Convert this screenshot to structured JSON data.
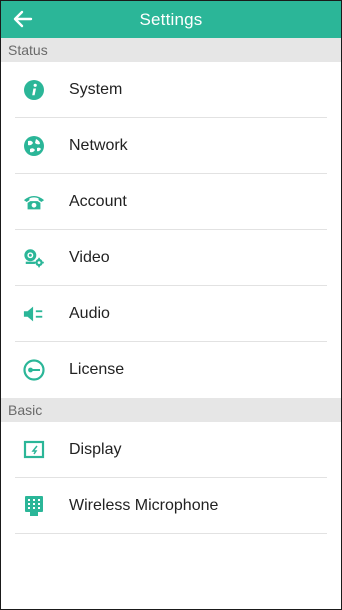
{
  "header": {
    "title": "Settings",
    "back_icon": "back-arrow-icon"
  },
  "colors": {
    "accent": "#2bb698",
    "section_bg": "#e6e6e6"
  },
  "sections": [
    {
      "label": "Status",
      "items": [
        {
          "label": "System",
          "icon": "info-icon"
        },
        {
          "label": "Network",
          "icon": "network-globe-icon"
        },
        {
          "label": "Account",
          "icon": "phone-icon"
        },
        {
          "label": "Video",
          "icon": "video-camera-gear-icon"
        },
        {
          "label": "Audio",
          "icon": "speaker-icon"
        },
        {
          "label": "License",
          "icon": "license-key-icon"
        }
      ]
    },
    {
      "label": "Basic",
      "items": [
        {
          "label": "Display",
          "icon": "display-icon"
        },
        {
          "label": "Wireless Microphone",
          "icon": "wireless-microphone-icon"
        }
      ]
    }
  ]
}
